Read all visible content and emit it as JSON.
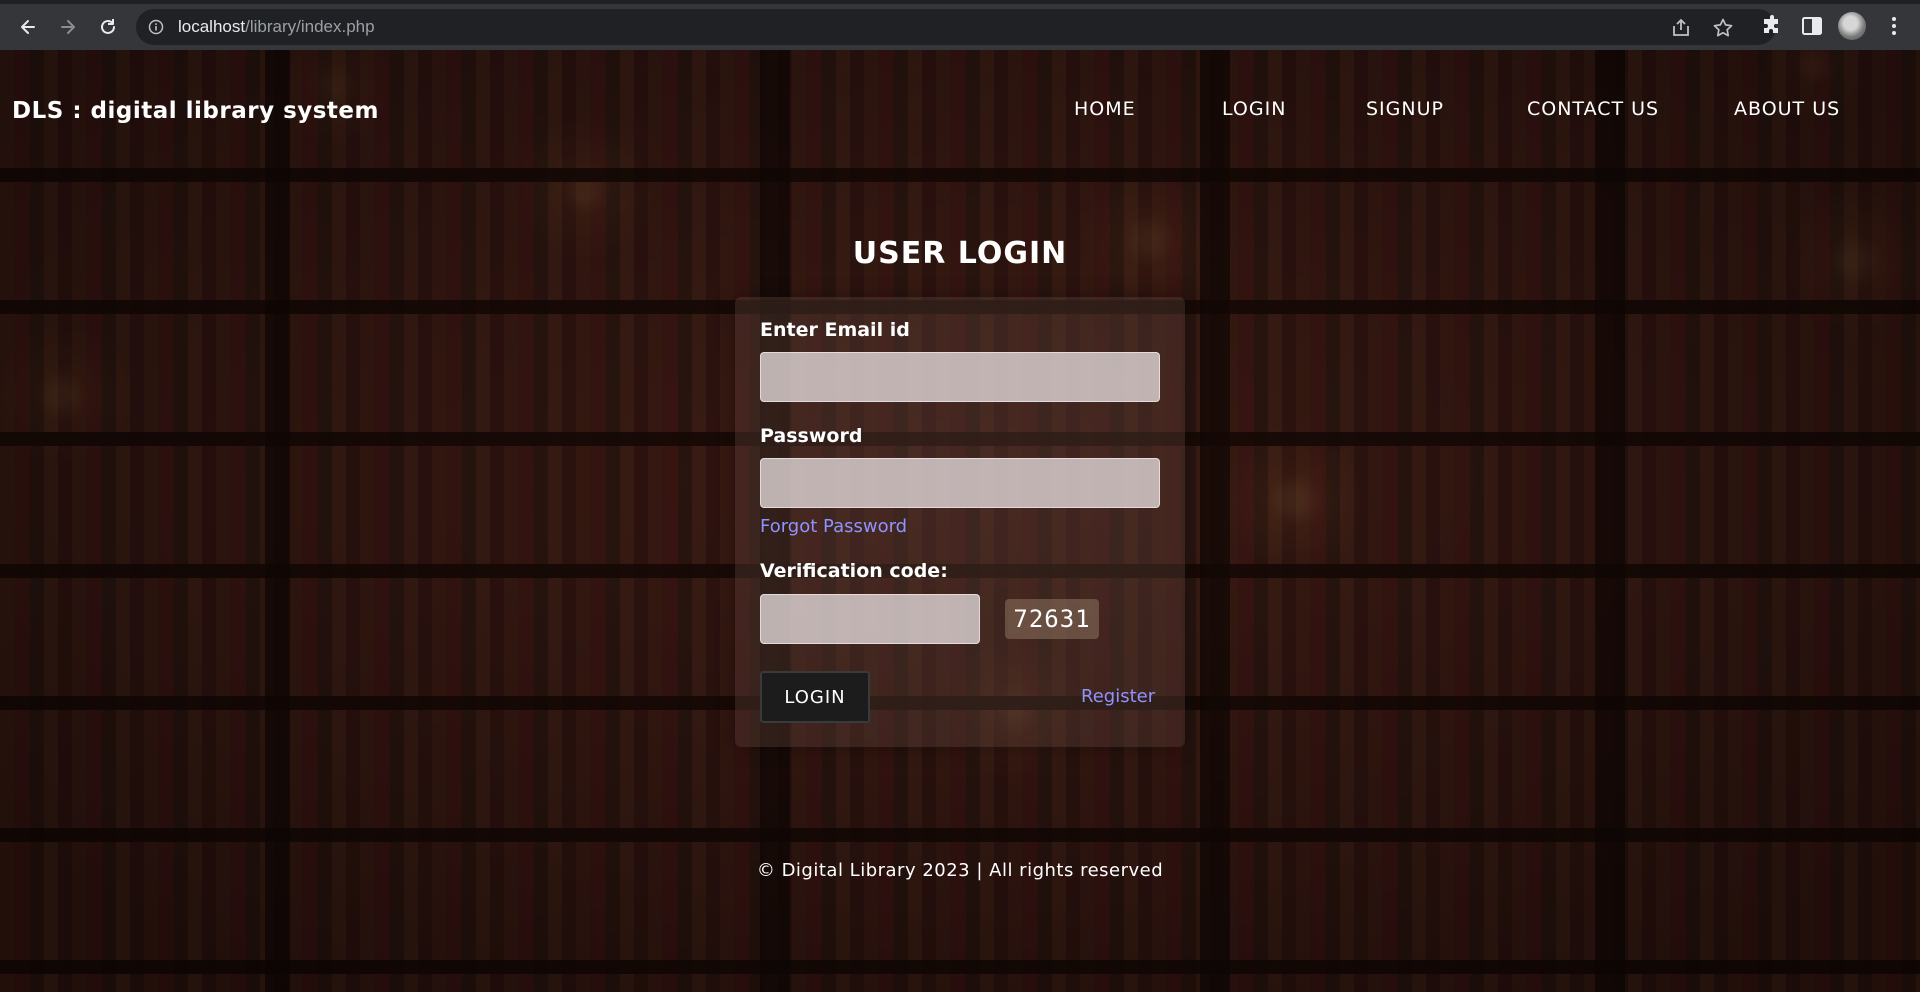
{
  "browser": {
    "url_host": "localhost",
    "url_path": "/library/index.php",
    "icons": [
      "back-icon",
      "forward-icon",
      "reload-icon",
      "info-icon",
      "share-icon",
      "bookmark-star-icon",
      "extensions-icon",
      "sidepanel-icon",
      "profile-avatar",
      "menu-kebab-icon"
    ]
  },
  "header": {
    "brand": "DLS : digital library system",
    "nav": [
      "HOME",
      "LOGIN",
      "SIGNUP",
      "CONTACT US",
      "ABOUT US"
    ]
  },
  "login": {
    "title": "USER LOGIN",
    "email_label": "Enter Email id",
    "email_value": "",
    "password_label": "Password",
    "password_value": "",
    "forgot_link": "Forgot Password",
    "verification_label": "Verification code:",
    "verification_value": "",
    "captcha": "72631",
    "login_button": "LOGIN",
    "register_link": "Register"
  },
  "footer": {
    "text": "© Digital Library 2023 | All rights reserved"
  },
  "colors": {
    "link": "#8f93ff",
    "button_bg": "#1c1c1c",
    "chrome_bg": "#35363a"
  }
}
